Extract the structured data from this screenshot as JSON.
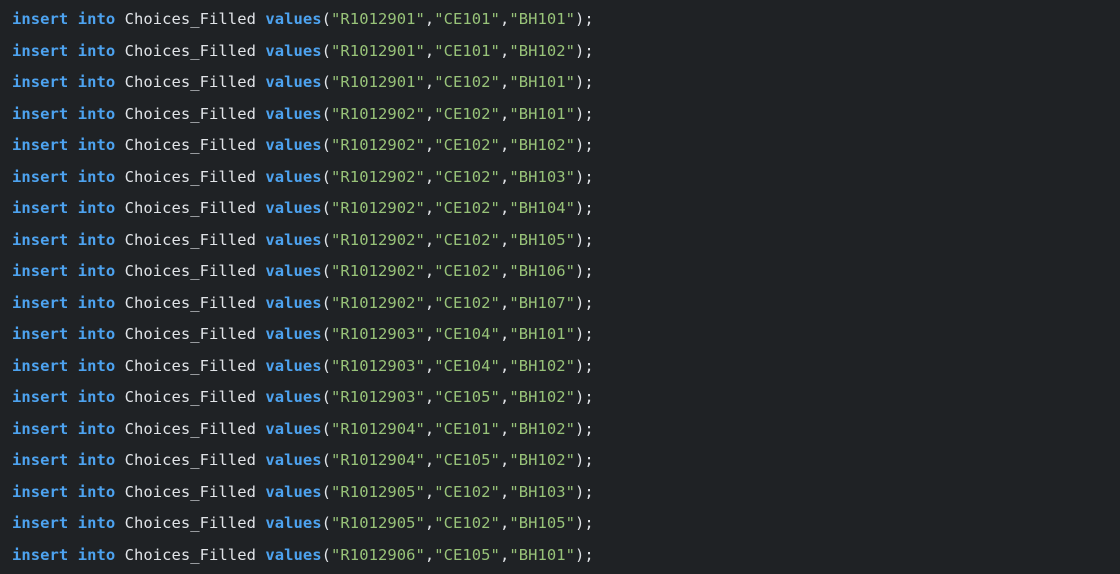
{
  "editor": {
    "lines": [
      {
        "kw1": "insert",
        "kw2": "into",
        "table": "Choices_Filled",
        "fn": "values",
        "v1": "\"R1012901\"",
        "v2": "\"CE101\"",
        "v3": "\"BH101\""
      },
      {
        "kw1": "insert",
        "kw2": "into",
        "table": "Choices_Filled",
        "fn": "values",
        "v1": "\"R1012901\"",
        "v2": "\"CE101\"",
        "v3": "\"BH102\""
      },
      {
        "kw1": "insert",
        "kw2": "into",
        "table": "Choices_Filled",
        "fn": "values",
        "v1": "\"R1012901\"",
        "v2": "\"CE102\"",
        "v3": "\"BH101\""
      },
      {
        "kw1": "insert",
        "kw2": "into",
        "table": "Choices_Filled",
        "fn": "values",
        "v1": "\"R1012902\"",
        "v2": "\"CE102\"",
        "v3": "\"BH101\""
      },
      {
        "kw1": "insert",
        "kw2": "into",
        "table": "Choices_Filled",
        "fn": "values",
        "v1": "\"R1012902\"",
        "v2": "\"CE102\"",
        "v3": "\"BH102\""
      },
      {
        "kw1": "insert",
        "kw2": "into",
        "table": "Choices_Filled",
        "fn": "values",
        "v1": "\"R1012902\"",
        "v2": "\"CE102\"",
        "v3": "\"BH103\""
      },
      {
        "kw1": "insert",
        "kw2": "into",
        "table": "Choices_Filled",
        "fn": "values",
        "v1": "\"R1012902\"",
        "v2": "\"CE102\"",
        "v3": "\"BH104\""
      },
      {
        "kw1": "insert",
        "kw2": "into",
        "table": "Choices_Filled",
        "fn": "values",
        "v1": "\"R1012902\"",
        "v2": "\"CE102\"",
        "v3": "\"BH105\""
      },
      {
        "kw1": "insert",
        "kw2": "into",
        "table": "Choices_Filled",
        "fn": "values",
        "v1": "\"R1012902\"",
        "v2": "\"CE102\"",
        "v3": "\"BH106\""
      },
      {
        "kw1": "insert",
        "kw2": "into",
        "table": "Choices_Filled",
        "fn": "values",
        "v1": "\"R1012902\"",
        "v2": "\"CE102\"",
        "v3": "\"BH107\""
      },
      {
        "kw1": "insert",
        "kw2": "into",
        "table": "Choices_Filled",
        "fn": "values",
        "v1": "\"R1012903\"",
        "v2": "\"CE104\"",
        "v3": "\"BH101\""
      },
      {
        "kw1": "insert",
        "kw2": "into",
        "table": "Choices_Filled",
        "fn": "values",
        "v1": "\"R1012903\"",
        "v2": "\"CE104\"",
        "v3": "\"BH102\""
      },
      {
        "kw1": "insert",
        "kw2": "into",
        "table": "Choices_Filled",
        "fn": "values",
        "v1": "\"R1012903\"",
        "v2": "\"CE105\"",
        "v3": "\"BH102\""
      },
      {
        "kw1": "insert",
        "kw2": "into",
        "table": "Choices_Filled",
        "fn": "values",
        "v1": "\"R1012904\"",
        "v2": "\"CE101\"",
        "v3": "\"BH102\""
      },
      {
        "kw1": "insert",
        "kw2": "into",
        "table": "Choices_Filled",
        "fn": "values",
        "v1": "\"R1012904\"",
        "v2": "\"CE105\"",
        "v3": "\"BH102\""
      },
      {
        "kw1": "insert",
        "kw2": "into",
        "table": "Choices_Filled",
        "fn": "values",
        "v1": "\"R1012905\"",
        "v2": "\"CE102\"",
        "v3": "\"BH103\""
      },
      {
        "kw1": "insert",
        "kw2": "into",
        "table": "Choices_Filled",
        "fn": "values",
        "v1": "\"R1012905\"",
        "v2": "\"CE102\"",
        "v3": "\"BH105\""
      },
      {
        "kw1": "insert",
        "kw2": "into",
        "table": "Choices_Filled",
        "fn": "values",
        "v1": "\"R1012906\"",
        "v2": "\"CE105\"",
        "v3": "\"BH101\""
      }
    ]
  }
}
